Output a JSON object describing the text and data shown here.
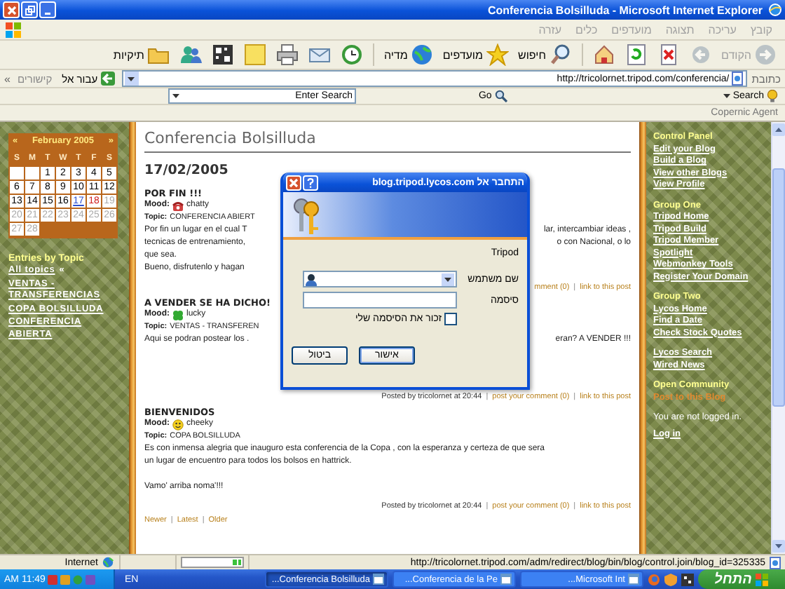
{
  "window": {
    "title": "Conferencia Bolsilluda - Microsoft Internet Explorer"
  },
  "menu": [
    "קובץ",
    "עריכה",
    "תצוגה",
    "מועדפים",
    "כלים",
    "עזרה"
  ],
  "toolbar": [
    {
      "kind": "back",
      "label": "הקודם",
      "disabled": true
    },
    {
      "kind": "forward",
      "disabled": true
    },
    {
      "kind": "stop",
      "disabled": false
    },
    {
      "kind": "refresh",
      "disabled": false
    },
    {
      "kind": "home",
      "disabled": false
    },
    {
      "kind": "search",
      "label": "חיפוש",
      "disabled": false
    },
    {
      "kind": "favorites",
      "label": "מועדפים",
      "disabled": false
    },
    {
      "kind": "media",
      "label": "מדיה",
      "disabled": false
    },
    {
      "kind": "history",
      "disabled": false
    },
    {
      "kind": "mail",
      "disabled": false
    },
    {
      "kind": "print",
      "disabled": false
    },
    {
      "kind": "note",
      "disabled": false
    },
    {
      "kind": "grid",
      "disabled": false
    },
    {
      "kind": "messenger",
      "disabled": false
    },
    {
      "kind": "folders",
      "label": "תיקיות",
      "disabled": false
    }
  ],
  "address_bar": {
    "label": "כתובת",
    "url": "http://tricolornet.tripod.com/conferencia/",
    "go": "עבור אל",
    "links": "קישורים",
    "links_chevron": "»"
  },
  "search_bar": {
    "label": "Search",
    "go": "Go",
    "placeholder": "Enter Search"
  },
  "copernic": "Copernic Agent",
  "calendar": {
    "title": "February 2005",
    "prev": "«",
    "next": "»",
    "weekdays": [
      "S",
      "M",
      "T",
      "W",
      "T",
      "F",
      "S"
    ],
    "days": [
      {
        "kind": "blank"
      },
      {
        "kind": "blank"
      },
      {
        "day": "1",
        "kind": "past"
      },
      {
        "day": "2",
        "kind": "past"
      },
      {
        "day": "3",
        "kind": "past"
      },
      {
        "day": "4",
        "kind": "past"
      },
      {
        "day": "5",
        "kind": "past"
      },
      {
        "day": "6",
        "kind": "past"
      },
      {
        "day": "7",
        "kind": "past"
      },
      {
        "day": "8",
        "kind": "past"
      },
      {
        "day": "9",
        "kind": "past"
      },
      {
        "day": "10",
        "kind": "past"
      },
      {
        "day": "11",
        "kind": "past"
      },
      {
        "day": "12",
        "kind": "past"
      },
      {
        "day": "13",
        "kind": "past"
      },
      {
        "day": "14",
        "kind": "past"
      },
      {
        "day": "15",
        "kind": "past"
      },
      {
        "day": "16",
        "kind": "past"
      },
      {
        "day": "17",
        "kind": "today"
      },
      {
        "day": "18",
        "kind": "next"
      },
      {
        "day": "19",
        "kind": "future"
      },
      {
        "day": "20",
        "kind": "future"
      },
      {
        "day": "21",
        "kind": "future"
      },
      {
        "day": "22",
        "kind": "future"
      },
      {
        "day": "23",
        "kind": "future"
      },
      {
        "day": "24",
        "kind": "future"
      },
      {
        "day": "25",
        "kind": "future"
      },
      {
        "day": "26",
        "kind": "future"
      },
      {
        "day": "27",
        "kind": "future"
      },
      {
        "day": "28",
        "kind": "future"
      }
    ]
  },
  "topics": {
    "title": "Entries by Topic",
    "all": "All topics",
    "all_mark": "«",
    "items": [
      "VENTAS - TRANSFERENCIAS",
      "COPA BOLSILLUDA",
      "CONFERENCIA ABIERTA"
    ]
  },
  "blog": {
    "title": "Conferencia Bolsilluda",
    "date": "17/02/2005",
    "posts": [
      {
        "title": "POR FIN !!!",
        "mood_label": "Mood:",
        "kind": "phone",
        "mood": "chatty",
        "topic_label": "Topic:",
        "topic": "CONFERENCIA ABIERT",
        "paragraphs": [
          [
            {
              "left": "Por fin un lugar en el cual T",
              "right": "lar, intercambiar ideas ,"
            },
            {
              "left": "tecnicas de entrenamiento,",
              "right": "o con Nacional, o lo"
            },
            {
              "left": "que sea."
            },
            {
              "left": "Bueno, disfrutenlo y hagan"
            }
          ]
        ],
        "footer": [
          {
            "kind": "link",
            "text": "mment (0)"
          },
          {
            "kind": "sep",
            "text": "|"
          },
          {
            "kind": "link",
            "text": "link to this post"
          }
        ]
      },
      {
        "title": "A VENDER SE HA DICHO!",
        "mood_label": "Mood:",
        "kind": "clover",
        "mood": "lucky",
        "topic_label": "Topic:",
        "topic": "VENTAS - TRANSFEREN",
        "paragraphs": [
          [
            {
              "left": "Aqui se podran postear los .",
              "right": "eran? A VENDER !!!"
            }
          ]
        ],
        "footer": [
          {
            "kind": "text",
            "text": "Posted by tricolornet at 20:44"
          },
          {
            "kind": "sep",
            "text": "|"
          },
          {
            "kind": "link",
            "text": "post your comment (0)"
          },
          {
            "kind": "sep",
            "text": "|"
          },
          {
            "kind": "link",
            "text": "link to this post"
          }
        ]
      },
      {
        "title": "BIENVENIDOS",
        "mood_label": "Mood:",
        "kind": "smiley",
        "mood": "cheeky",
        "topic_label": "Topic:",
        "topic": "COPA BOLSILLUDA",
        "paragraphs": [
          [
            {
              "left": "Es con inmensa alegria que inauguro esta conferencia de la Copa , con la esperanza y certeza de que sera"
            },
            {
              "left": "un lugar de encuentro para todos los bolsos en hattrick."
            }
          ],
          [
            {
              "left": "Vamo' arriba noma'!!!"
            }
          ]
        ],
        "footer": [
          {
            "kind": "text",
            "text": "Posted by tricolornet at 20:44"
          },
          {
            "kind": "sep",
            "text": "|"
          },
          {
            "kind": "link",
            "text": "post your comment (0)"
          },
          {
            "kind": "sep",
            "text": "|"
          },
          {
            "kind": "link",
            "text": "link to this post"
          }
        ]
      }
    ],
    "nav": [
      {
        "kind": "link",
        "text": "Newer"
      },
      {
        "kind": "sep",
        "text": "|"
      },
      {
        "kind": "link",
        "text": "Latest"
      },
      {
        "kind": "sep",
        "text": "|"
      },
      {
        "kind": "link",
        "text": "Older"
      }
    ]
  },
  "right_sidebar": {
    "groups": [
      {
        "title": "Control Panel",
        "links": [
          "Edit your Blog",
          "Build a Blog",
          "View other Blogs",
          "View Profile"
        ]
      },
      {
        "title": "Group One",
        "links": [
          "Tripod Home",
          "Tripod Build",
          "Tripod Member",
          "Spotlight",
          "Webmonkey Tools",
          "Register Your Domain"
        ]
      },
      {
        "title": "Group Two",
        "links": [
          "Lycos Home",
          "Find a Date",
          "Check Stock Quotes"
        ]
      },
      {
        "links": [
          "Lycos Search",
          "Wired News"
        ]
      }
    ],
    "community": {
      "title": "Open Community",
      "post_link": "Post to this Blog",
      "note": "You are not logged in.",
      "login": "Log in"
    }
  },
  "dialog": {
    "title": "התחבר אל blog.tripod.lycos.com",
    "realm": "Tripod",
    "username_label": "שם משתמש",
    "password_label": "סיסמה",
    "remember": {
      "label": "זכור את הסיסמה שלי",
      "checked": false
    },
    "buttons": [
      {
        "label": "אישור",
        "default": true
      },
      {
        "label": "ביטול",
        "default": false
      }
    ]
  },
  "status_bar": {
    "url": "http://tricolornet.tripod.com/adm/redirect/blog/bin/blog/control.join/blog_id=325335",
    "progress": {
      "level": 0.15
    },
    "zone": "Internet"
  },
  "taskbar": {
    "start": "התחל",
    "tasks": [
      {
        "label": "...Conferencia Bolsilluda",
        "selected": true
      },
      {
        "label": "...Conferencia de la Pe",
        "selected": false
      },
      {
        "label": "...Microsoft Int",
        "selected": false
      }
    ],
    "language": "EN",
    "clock": "AM 11:49"
  }
}
